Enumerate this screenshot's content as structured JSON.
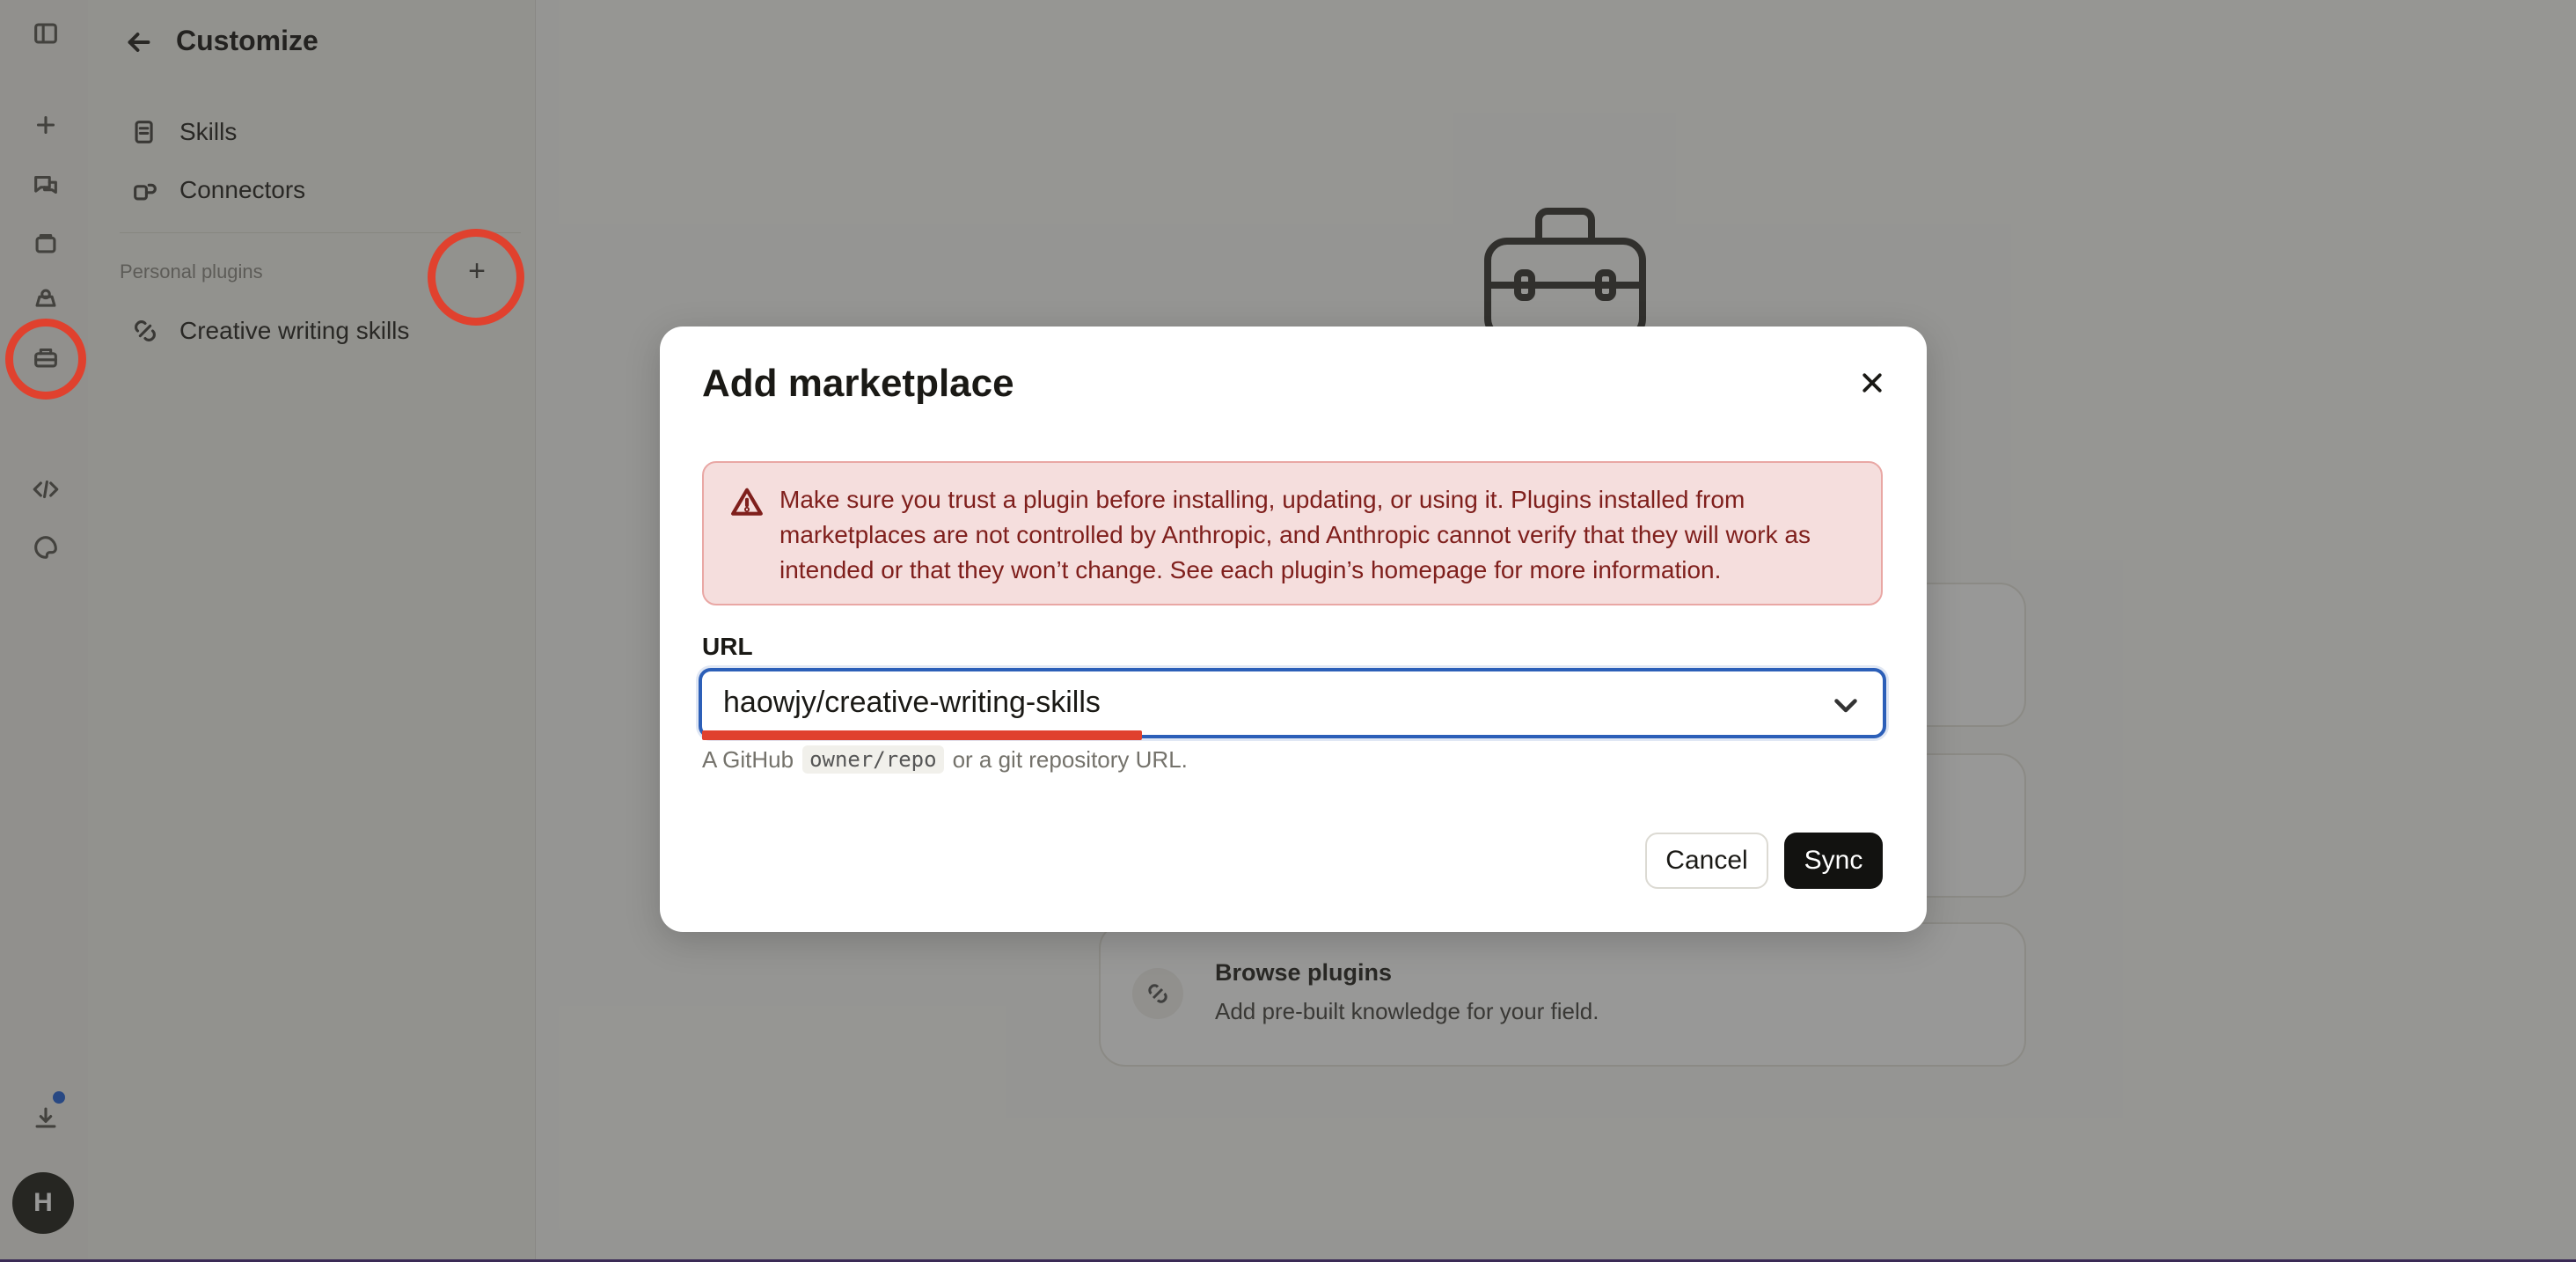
{
  "sidebar": {
    "title": "Customize",
    "items": [
      {
        "label": "Skills",
        "icon": "skills-icon"
      },
      {
        "label": "Connectors",
        "icon": "connectors-icon"
      }
    ],
    "section_label": "Personal plugins",
    "add_label": "+",
    "plugins": [
      {
        "label": "Creative writing skills",
        "icon": "plugin-icon"
      }
    ]
  },
  "rail": {
    "avatar_initial": "H",
    "icons": [
      "sidebar-toggle-icon",
      "new-chat-icon",
      "chats-icon",
      "projects-icon",
      "artifacts-icon",
      "customize-icon",
      "code-icon",
      "settings-icon",
      "download-icon"
    ]
  },
  "main": {
    "cards": [
      {
        "title": "",
        "desc": ""
      },
      {
        "title": "",
        "desc": ""
      },
      {
        "title": "Browse plugins",
        "desc": "Add pre-built knowledge for your field."
      }
    ]
  },
  "modal": {
    "title": "Add marketplace",
    "warning": "Make sure you trust a plugin before installing, updating, or using it. Plugins installed from marketplaces are not controlled by Anthropic, and Anthropic cannot verify that they will work as intended or that they won’t change. See each plugin’s homepage for more information.",
    "url_label": "URL",
    "url_value": "haowjy/creative-writing-skills",
    "hint_prefix": "A GitHub",
    "hint_code": "owner/repo",
    "hint_suffix": "or a git repository URL.",
    "cancel_label": "Cancel",
    "sync_label": "Sync"
  },
  "colors": {
    "accent_focus": "#2c5fb8",
    "warning_bg": "#f5dedd",
    "warning_text": "#7f1f1c",
    "annotation": "#e0412e",
    "primary_button": "#121210"
  }
}
